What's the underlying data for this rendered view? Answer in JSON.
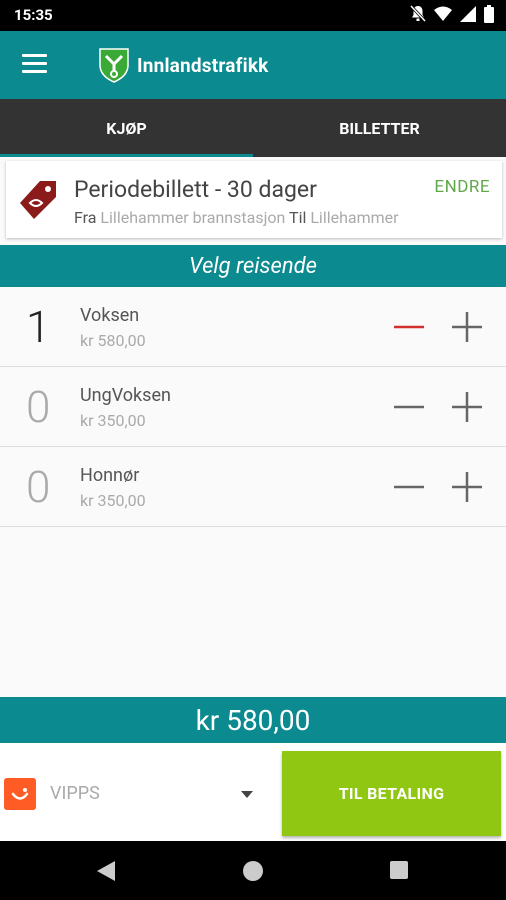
{
  "status_bar": {
    "time": "15:35"
  },
  "app_bar": {
    "brand": "Innlandstrafikk"
  },
  "tabs": [
    {
      "label": "KJØP",
      "active": true
    },
    {
      "label": "BILLETTER",
      "active": false
    }
  ],
  "ticket": {
    "title": "Periodebillett - 30 dager",
    "edit_label": "ENDRE",
    "from_prefix": "Fra",
    "from": "Lillehammer brannstasjon",
    "to_prefix": "Til",
    "to": "Lillehammer"
  },
  "section_title": "Velg reisende",
  "travelers": [
    {
      "count": "1",
      "label": "Voksen",
      "price": "kr 580,00"
    },
    {
      "count": "0",
      "label": "UngVoksen",
      "price": "kr 350,00"
    },
    {
      "count": "0",
      "label": "Honnør",
      "price": "kr 350,00"
    }
  ],
  "total": "kr 580,00",
  "payment": {
    "method": "VIPPS",
    "button_label": "TIL BETALING"
  },
  "colors": {
    "brand": "#0b8a8f",
    "accent_green": "#8fc713",
    "minus_active": "#d32f2f",
    "vipps": "#ff5b24"
  }
}
